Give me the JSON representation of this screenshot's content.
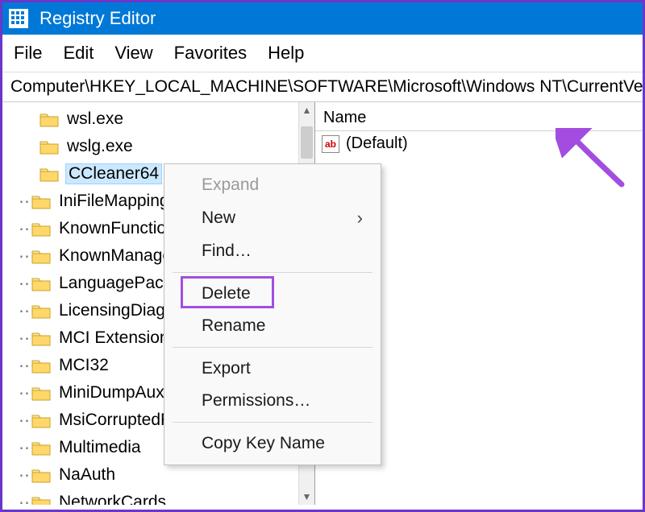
{
  "title": "Registry Editor",
  "menu": {
    "file": "File",
    "edit": "Edit",
    "view": "View",
    "favorites": "Favorites",
    "help": "Help"
  },
  "address": "Computer\\HKEY_LOCAL_MACHINE\\SOFTWARE\\Microsoft\\Windows NT\\CurrentVers",
  "tree": {
    "items": [
      {
        "label": "wsl.exe",
        "indent": 1,
        "selected": false
      },
      {
        "label": "wslg.exe",
        "indent": 1,
        "selected": false
      },
      {
        "label": "CCleaner64",
        "indent": 1,
        "selected": true
      },
      {
        "label": "IniFileMapping",
        "indent": 0,
        "selected": false
      },
      {
        "label": "KnownFunction",
        "indent": 0,
        "selected": false
      },
      {
        "label": "KnownManage",
        "indent": 0,
        "selected": false
      },
      {
        "label": "LanguagePack",
        "indent": 0,
        "selected": false
      },
      {
        "label": "LicensingDiag",
        "indent": 0,
        "selected": false
      },
      {
        "label": "MCI Extensions",
        "indent": 0,
        "selected": false
      },
      {
        "label": "MCI32",
        "indent": 0,
        "selected": false
      },
      {
        "label": "MiniDumpAux",
        "indent": 0,
        "selected": false
      },
      {
        "label": "MsiCorruptedF",
        "indent": 0,
        "selected": false
      },
      {
        "label": "Multimedia",
        "indent": 0,
        "selected": false
      },
      {
        "label": "NaAuth",
        "indent": 0,
        "selected": false
      },
      {
        "label": "NetworkCards",
        "indent": 0,
        "selected": false
      }
    ]
  },
  "list": {
    "header": {
      "name": "Name"
    },
    "rows": [
      {
        "name": "(Default)",
        "iconText": "ab"
      }
    ]
  },
  "contextmenu": {
    "items": {
      "expand": "Expand",
      "new": "New",
      "find": "Find…",
      "delete": "Delete",
      "rename": "Rename",
      "export": "Export",
      "permissions": "Permissions…",
      "copykey": "Copy Key Name"
    }
  },
  "colors": {
    "accent": "#0078d7",
    "highlight": "#a24de0",
    "selection": "#cce8ff"
  }
}
